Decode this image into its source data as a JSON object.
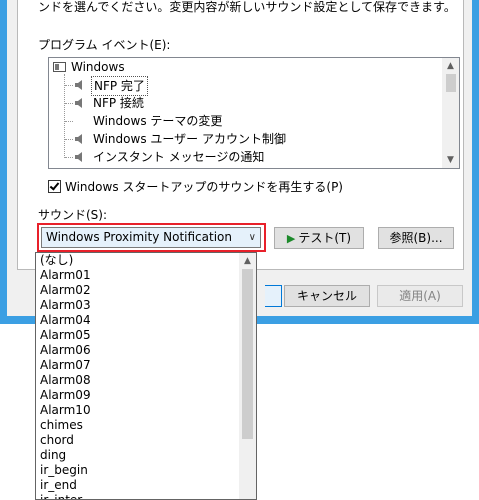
{
  "instructions_text": "ンドを選んでください。変更内容が新しいサウンド設定として保存できます。",
  "events_label": "プログラム イベント(E):",
  "events": [
    {
      "label": "Windows",
      "kind": "group"
    },
    {
      "label": "NFP 完了",
      "kind": "sound",
      "selected": true
    },
    {
      "label": "NFP 接続",
      "kind": "sound"
    },
    {
      "label": "Windows テーマの変更",
      "kind": "none"
    },
    {
      "label": "Windows ユーザー アカウント制御",
      "kind": "sound"
    },
    {
      "label": "インスタント メッセージの通知",
      "kind": "sound"
    }
  ],
  "startup_checkbox": {
    "label": "Windows スタートアップのサウンドを再生する(P)",
    "checked": true
  },
  "sound_label": "サウンド(S):",
  "sound_combo": {
    "value": "Windows Proximity Notification"
  },
  "test_button": "テスト(T)",
  "browse_button": "参照(B)...",
  "cancel_button": "キャンセル",
  "apply_button": "適用(A)",
  "dropdown_options": [
    "(なし)",
    "Alarm01",
    "Alarm02",
    "Alarm03",
    "Alarm04",
    "Alarm05",
    "Alarm06",
    "Alarm07",
    "Alarm08",
    "Alarm09",
    "Alarm10",
    "chimes",
    "chord",
    "ding",
    "ir_begin",
    "ir_end",
    "ir_inter"
  ],
  "colors": {
    "accent_blue": "#3b9fe3",
    "highlight_red": "#e8202a",
    "play_green": "#1d8a2b"
  }
}
